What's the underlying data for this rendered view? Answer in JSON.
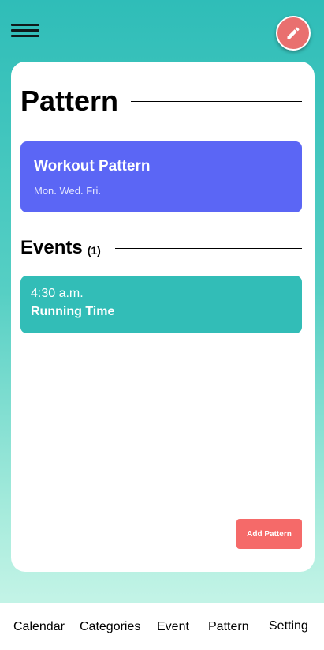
{
  "header": {
    "menu_icon": "hamburger-menu-icon",
    "edit_icon": "pencil-icon",
    "edit_button_color": "#e9706f"
  },
  "page": {
    "title": "Pattern"
  },
  "pattern": {
    "name": "Workout Pattern",
    "days": "Mon. Wed. Fri.",
    "color": "#5b66f5"
  },
  "events": {
    "heading": "Events",
    "count": "(1)",
    "items": [
      {
        "time": "4:30 a.m.",
        "title": "Running Time",
        "color": "#32bdb7"
      }
    ]
  },
  "actions": {
    "add_pattern_label": "Add Pattern",
    "add_pattern_color": "#f56a69"
  },
  "nav": {
    "items": [
      {
        "label": "Calendar"
      },
      {
        "label": "Categories"
      },
      {
        "label": "Event"
      },
      {
        "label": "Pattern"
      },
      {
        "label": "Setting"
      }
    ]
  }
}
